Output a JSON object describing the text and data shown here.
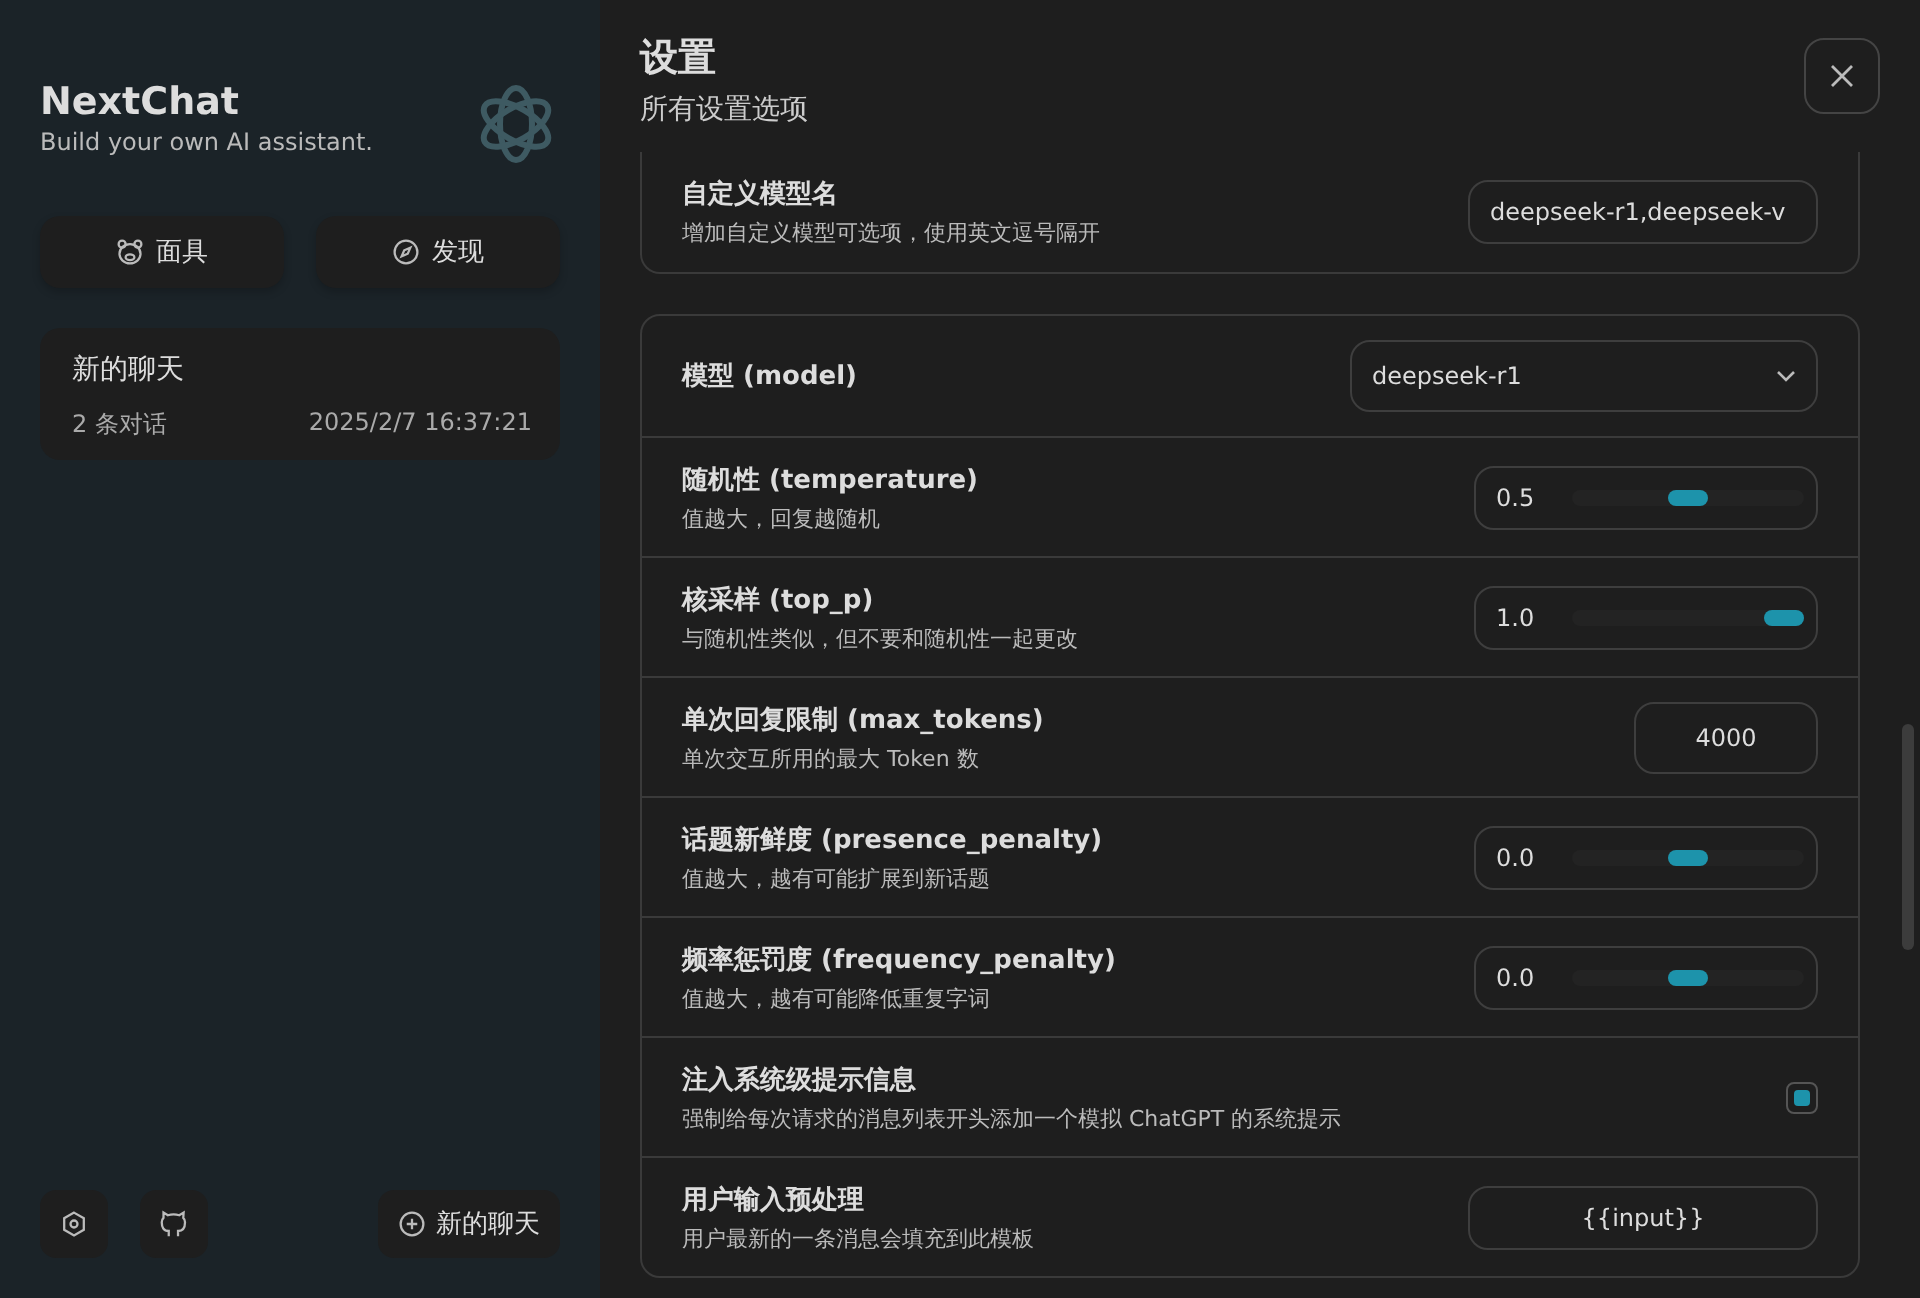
{
  "sidebar": {
    "title": "NextChat",
    "subtitle": "Build your own AI assistant.",
    "buttons": [
      {
        "kind": "mask",
        "label": "面具"
      },
      {
        "kind": "discover",
        "label": "发现"
      }
    ],
    "chats": [
      {
        "title": "新的聊天",
        "count": "2 条对话",
        "time": "2025/2/7 16:37:21",
        "selected": false
      }
    ],
    "new_chat": "新的聊天"
  },
  "settings": {
    "title": "设置",
    "subtitle": "所有设置选项",
    "groups": [
      {
        "rows": [
          {
            "kind": "input",
            "title": "自定义模型名",
            "subtitle": "增加自定义模型可选项，使用英文逗号隔开",
            "value": "deepseek-r1,deepseek-v"
          }
        ]
      },
      {
        "rows": [
          {
            "kind": "select",
            "title": "模型 (model)",
            "value": "deepseek-r1"
          },
          {
            "kind": "slider",
            "title": "随机性 (temperature)",
            "subtitle": "值越大，回复越随机",
            "value": "0.5",
            "level": 0.5
          },
          {
            "kind": "slider",
            "title": "核采样 (top_p)",
            "subtitle": "与随机性类似，但不要和随机性一起更改",
            "value": "1.0",
            "level": 1.0
          },
          {
            "kind": "number",
            "title": "单次回复限制 (max_tokens)",
            "subtitle": "单次交互所用的最大 Token 数",
            "value": "4000"
          },
          {
            "kind": "slider",
            "title": "话题新鲜度 (presence_penalty)",
            "subtitle": "值越大，越有可能扩展到新话题",
            "value": "0.0",
            "level": 0.5
          },
          {
            "kind": "slider",
            "title": "频率惩罚度 (frequency_penalty)",
            "subtitle": "值越大，越有可能降低重复字词",
            "value": "0.0",
            "level": 0.5
          },
          {
            "kind": "checkbox",
            "title": "注入系统级提示信息",
            "subtitle": "强制给每次请求的消息列表开头添加一个模拟 ChatGPT 的系统提示",
            "checked": true
          },
          {
            "kind": "template",
            "title": "用户输入预处理",
            "subtitle": "用户最新的一条消息会填充到此模板",
            "value": "{{input}}"
          }
        ]
      }
    ]
  }
}
